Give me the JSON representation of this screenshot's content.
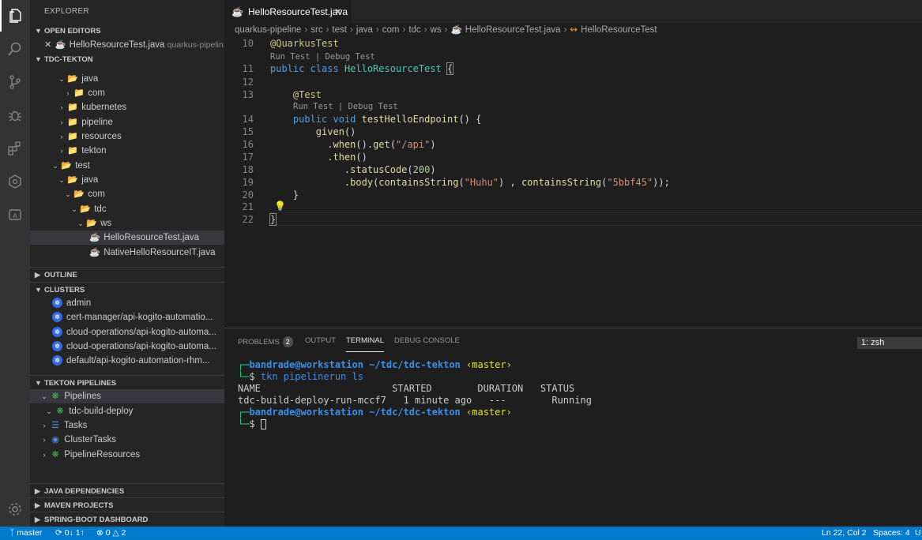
{
  "activity_bar": {
    "icons": [
      "explorer-icon",
      "search-icon",
      "source-control-icon",
      "debug-icon",
      "extensions-icon",
      "kubernetes-icon",
      "tekton-icon"
    ],
    "bottom_icon": "gear-icon"
  },
  "sidebar": {
    "title": "EXPLORER",
    "open_editors": {
      "header": "OPEN EDITORS",
      "item": {
        "name": "HelloResourceTest.java",
        "path": "quarkus-pipelin..."
      }
    },
    "project": {
      "header": "TDC-TEKTON",
      "items": [
        {
          "label": "java"
        },
        {
          "label": "com"
        },
        {
          "label": "kubernetes"
        },
        {
          "label": "pipeline"
        },
        {
          "label": "resources"
        },
        {
          "label": "tekton"
        },
        {
          "label": "test"
        },
        {
          "label": "java"
        },
        {
          "label": "com"
        },
        {
          "label": "tdc"
        },
        {
          "label": "ws"
        },
        {
          "label": "HelloResourceTest.java"
        },
        {
          "label": "NativeHelloResourceIT.java"
        }
      ]
    },
    "outline_header": "OUTLINE",
    "clusters": {
      "header": "CLUSTERS",
      "items": [
        {
          "label": "admin"
        },
        {
          "label": "cert-manager/api-kogito-automatio..."
        },
        {
          "label": "cloud-operations/api-kogito-automa..."
        },
        {
          "label": "cloud-operations/api-kogito-automa..."
        },
        {
          "label": "default/api-kogito-automation-rhm..."
        }
      ]
    },
    "tekton": {
      "header": "TEKTON PIPELINES",
      "items": [
        {
          "label": "Pipelines"
        },
        {
          "label": "tdc-build-deploy"
        },
        {
          "label": "Tasks"
        },
        {
          "label": "ClusterTasks"
        },
        {
          "label": "PipelineResources"
        }
      ]
    },
    "bottom_sections": [
      "JAVA DEPENDENCIES",
      "MAVEN PROJECTS",
      "SPRING-BOOT DASHBOARD"
    ]
  },
  "editor": {
    "tab": {
      "label": "HelloResourceTest.java"
    },
    "breadcrumb": [
      "quarkus-pipeline",
      "src",
      "test",
      "java",
      "com",
      "tdc",
      "ws",
      "HelloResourceTest.java",
      "HelloResourceTest"
    ],
    "code_lens_1": "Run Test | Debug Test",
    "code_lens_2": "Run Test | Debug Test",
    "lines": [
      {
        "num": "10",
        "text": "@QuarkusTest"
      },
      {
        "num": "11",
        "text": "public class HelloResourceTest {"
      },
      {
        "num": "12",
        "text": ""
      },
      {
        "num": "13",
        "text": "    @Test"
      },
      {
        "num": "14",
        "text": "    public void testHelloEndpoint() {"
      },
      {
        "num": "15",
        "text": "        given()"
      },
      {
        "num": "16",
        "text": "          .when().get(\"/api\")"
      },
      {
        "num": "17",
        "text": "          .then()"
      },
      {
        "num": "18",
        "text": "             .statusCode(200)"
      },
      {
        "num": "19",
        "text": "             .body(containsString(\"Huhu\") , containsString(\"5bbf45\"));"
      },
      {
        "num": "20",
        "text": "    }"
      },
      {
        "num": "21",
        "text": ""
      },
      {
        "num": "22",
        "text": "}"
      }
    ]
  },
  "panel": {
    "tabs": [
      {
        "label": "PROBLEMS",
        "badge": "2"
      },
      {
        "label": "OUTPUT"
      },
      {
        "label": "TERMINAL"
      },
      {
        "label": "DEBUG CONSOLE"
      }
    ],
    "terminal_select": "1: zsh",
    "terminal": {
      "prompt_user": "bandrade@workstation",
      "prompt_path": "~/tdc/tdc-tekton",
      "prompt_branch": "‹master›",
      "command": "tkn pipelinerun ls",
      "table_header": "NAME                       STARTED        DURATION   STATUS",
      "table_row": "tdc-build-deploy-run-mccf7   1 minute ago   ---        Running"
    }
  },
  "statusbar": {
    "branch": "master",
    "sync": "0↓ 1↑",
    "errors": "0",
    "warnings": "2",
    "position": "Ln 22, Col 2",
    "spaces": "Spaces: 4",
    "encoding": "U"
  }
}
